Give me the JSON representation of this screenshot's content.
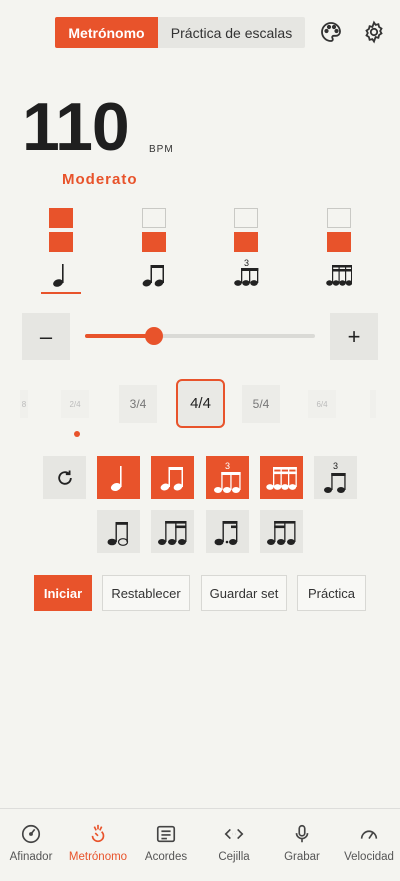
{
  "tabs": {
    "metronome": "Metrónomo",
    "scales": "Práctica de escalas"
  },
  "bpm": {
    "value": "110",
    "unit": "BPM",
    "tempo": "Moderato",
    "level": 0.3
  },
  "beats": [
    {
      "top": true,
      "bottom": true,
      "subdivision": "quarter"
    },
    {
      "top": false,
      "bottom": true,
      "subdivision": "eighths"
    },
    {
      "top": false,
      "bottom": true,
      "subdivision": "triplet"
    },
    {
      "top": false,
      "bottom": true,
      "subdivision": "sixteenths"
    }
  ],
  "controls": {
    "minus": "–",
    "plus": "+"
  },
  "time_signatures": {
    "far_left": "8",
    "left2": "2/4",
    "left1": "3/4",
    "current": "4/4",
    "right1": "5/4",
    "right2": "6/4"
  },
  "subdivision_badge": "3",
  "actions": {
    "start": "Iniciar",
    "reset": "Restablecer",
    "save": "Guardar set",
    "practice": "Práctica"
  },
  "nav": [
    {
      "label": "Afinador",
      "icon": "tuner-icon"
    },
    {
      "label": "Metrónomo",
      "icon": "metronome-icon"
    },
    {
      "label": "Acordes",
      "icon": "chords-icon"
    },
    {
      "label": "Cejilla",
      "icon": "capo-icon"
    },
    {
      "label": "Grabar",
      "icon": "microphone-icon"
    },
    {
      "label": "Velocidad",
      "icon": "speed-icon"
    }
  ],
  "colors": {
    "accent": "#e8532b",
    "background": "#f4f4f0"
  }
}
